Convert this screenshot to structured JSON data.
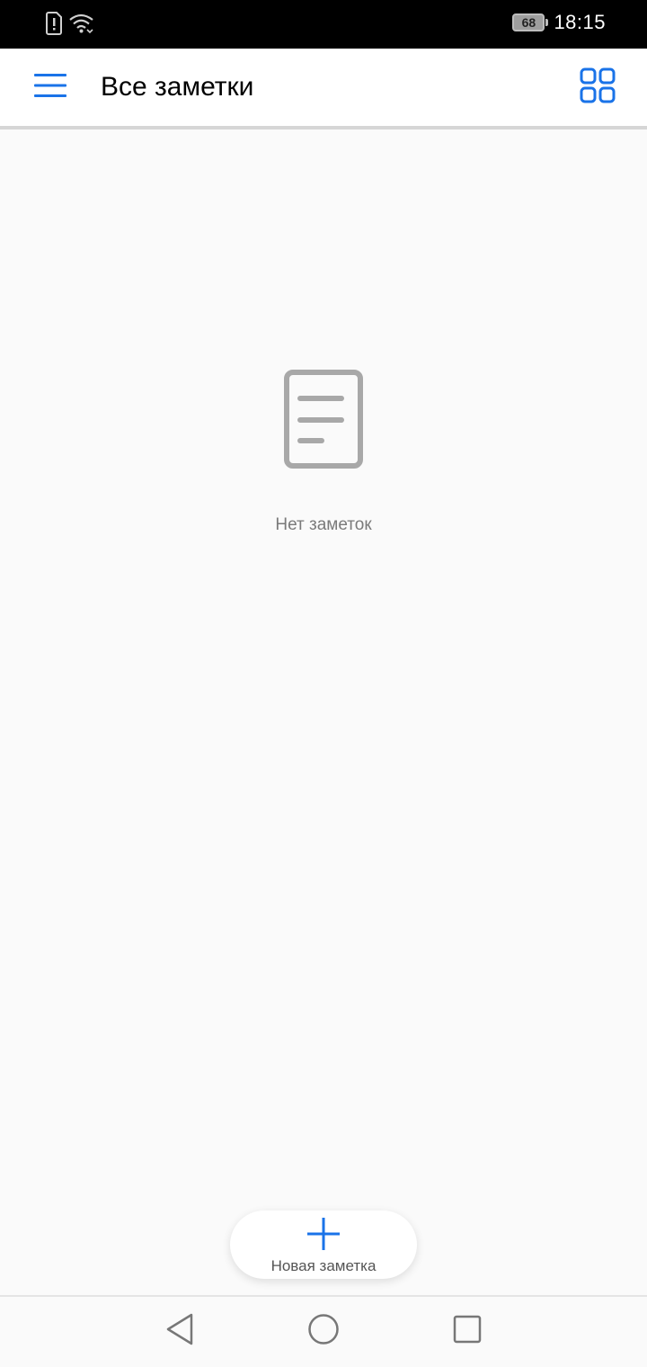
{
  "status_bar": {
    "left_icons": [
      "sim-alert-icon",
      "wifi-icon"
    ],
    "battery_level": "68",
    "time": "18:15"
  },
  "app_bar": {
    "title": "Все заметки",
    "menu_icon": "hamburger-menu-icon",
    "view_toggle_icon": "grid-view-icon",
    "accent_color": "#1a73e8"
  },
  "empty_state": {
    "icon": "document-icon",
    "message": "Нет заметок"
  },
  "fab": {
    "icon": "plus-icon",
    "label": "Новая заметка"
  },
  "nav_bar": {
    "buttons": [
      "back-icon",
      "home-icon",
      "recent-apps-icon"
    ]
  }
}
